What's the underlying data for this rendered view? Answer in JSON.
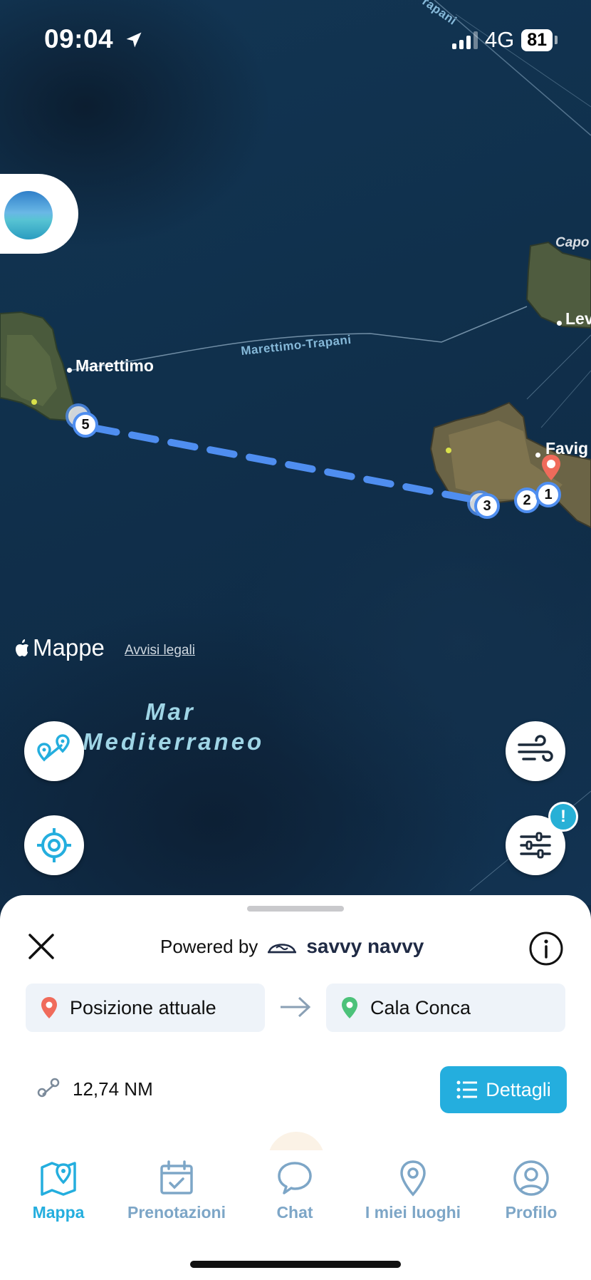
{
  "status_bar": {
    "time": "09:04",
    "network": "4G",
    "battery": "81"
  },
  "map": {
    "towns": {
      "marettimo": "Marettimo",
      "favignana": "Favig",
      "levanzo": "Lev",
      "capo": "Capo"
    },
    "ferry_route": "Marettimo-Trapani",
    "ferry_route_top": "rapani",
    "sea_label_line1": "Mar",
    "sea_label_line2": "Mediterraneo",
    "attribution": "Mappe",
    "legal_link": "Avvisi legali",
    "waypoints": [
      "1",
      "2",
      "3",
      "5"
    ],
    "alert_badge": "!"
  },
  "sheet": {
    "powered_by": "Powered by",
    "brand": "savvy navvy",
    "origin": "Posizione attuale",
    "destination": "Cala Conca",
    "distance": "12,74 NM",
    "details_button": "Dettagli"
  },
  "tabs": [
    {
      "label": "Mappa",
      "icon": "map-icon",
      "active": true
    },
    {
      "label": "Prenotazioni",
      "icon": "calendar-icon",
      "active": false
    },
    {
      "label": "Chat",
      "icon": "chat-icon",
      "active": false
    },
    {
      "label": "I miei luoghi",
      "icon": "pin-icon",
      "active": false
    },
    {
      "label": "Profilo",
      "icon": "profile-icon",
      "active": false
    }
  ],
  "colors": {
    "accent": "#24aede",
    "route": "#4f8ef0",
    "tab_inactive": "#7da6c7",
    "origin_pin": "#f06b5b",
    "dest_pin": "#4cc27a"
  }
}
